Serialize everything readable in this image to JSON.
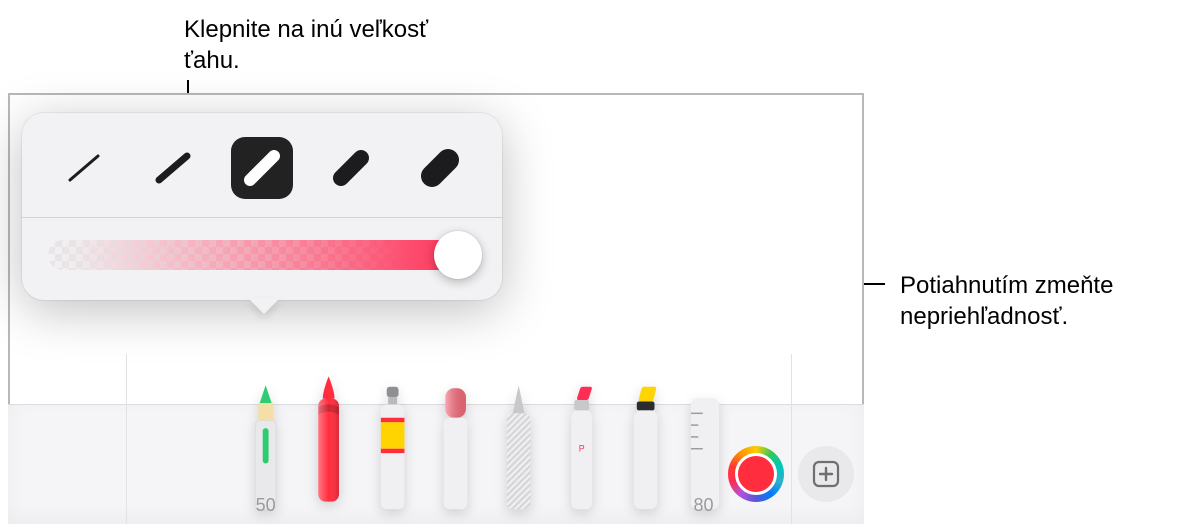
{
  "callouts": {
    "stroke_size": "Klepnite na inú veľkosť ťahu.",
    "opacity": "Potiahnutím zmeňte nepriehľadnosť."
  },
  "stroke_popover": {
    "sizes": [
      1,
      2,
      3,
      4,
      5
    ],
    "selected_index": 2,
    "opacity_percent": 100
  },
  "tools": {
    "items": [
      {
        "name": "pencil",
        "label": "50"
      },
      {
        "name": "crayon",
        "label": ""
      },
      {
        "name": "marker",
        "label": ""
      },
      {
        "name": "eraser",
        "label": ""
      },
      {
        "name": "pointer",
        "label": ""
      },
      {
        "name": "pen",
        "label": ""
      },
      {
        "name": "highlighter",
        "label": ""
      },
      {
        "name": "scale",
        "label": "80"
      }
    ],
    "selected_index": 1
  },
  "colors": {
    "current": "#ff2d3e"
  }
}
